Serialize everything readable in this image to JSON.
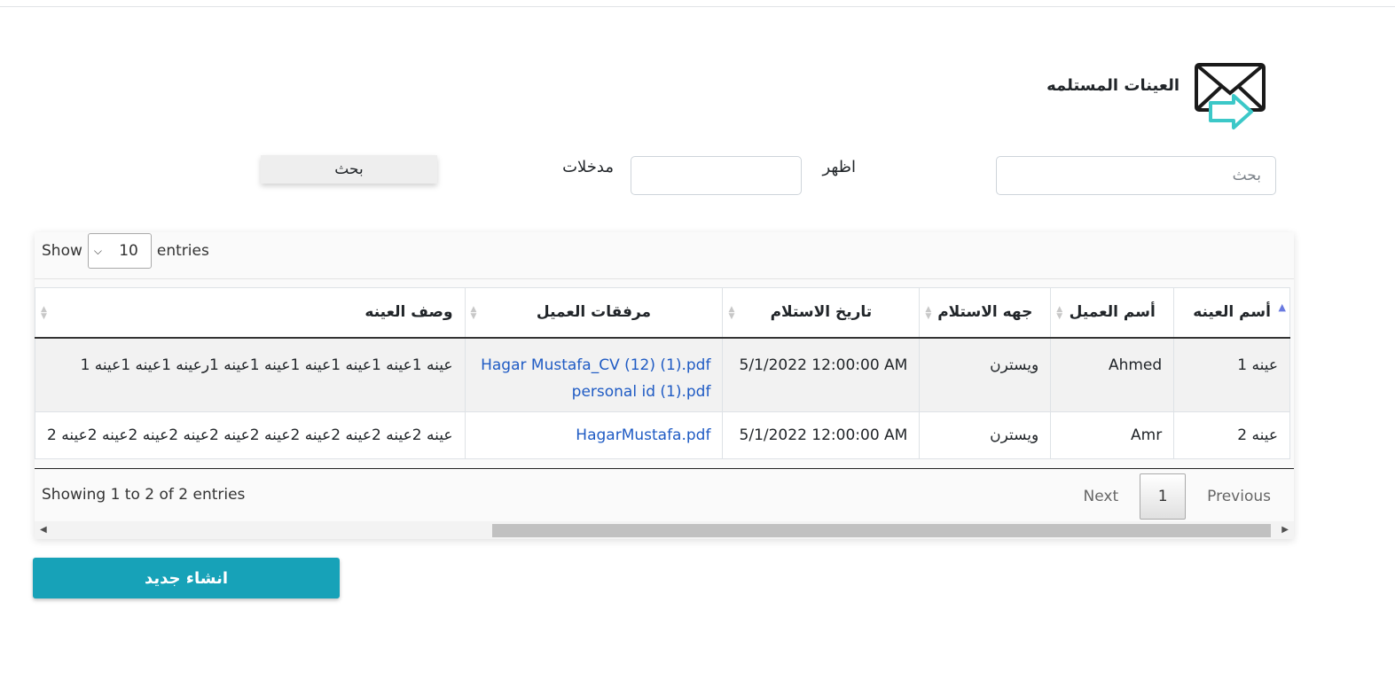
{
  "header": {
    "title": "العينات المستلمه"
  },
  "filters": {
    "search_placeholder": "بحث",
    "show_label": "اظهر",
    "count_value": "",
    "entries_label": "مدخلات",
    "search_button": "بحث"
  },
  "table": {
    "length": {
      "show": "Show",
      "value": "10",
      "entries": "entries"
    },
    "columns": [
      "أسم العينه",
      "أسم العميل",
      "جهه الاستلام",
      "تاريخ الاستلام",
      "مرفقات العميل",
      "وصف العينه"
    ],
    "rows": [
      {
        "sample_name": "عينه 1",
        "client_name": "Ahmed",
        "receiver": "ويسترن",
        "received_date": "5/1/2022 12:00:00 AM",
        "attachments": [
          "Hagar Mustafa_CV (12) (1).pdf",
          "personal id (1).pdf"
        ],
        "description": "عينه 1عينه 1عينه 1عينه 1عينه 1عينه 1رعينه 1عينه 1عينه 1"
      },
      {
        "sample_name": "عينه 2",
        "client_name": "Amr",
        "receiver": "ويسترن",
        "received_date": "5/1/2022 12:00:00 AM",
        "attachments": [
          "HagarMustafa.pdf"
        ],
        "description": "عينه 2عينه 2عينه 2عينه 2عينه 2عينه 2عينه 2عينه 2عينه 2عينه 2"
      }
    ],
    "info": "Showing 1 to 2 of 2 entries",
    "pagination": {
      "previous": "Previous",
      "current": "1",
      "next": "Next"
    }
  },
  "actions": {
    "create_label": "انشاء جديد"
  },
  "colors": {
    "accent": "#17a2b8",
    "link": "#1f5bc4",
    "icon_arrow": "#3cc8c8"
  },
  "icons": [
    "envelope-arrow-icon",
    "sort-icon",
    "chevron-down-icon",
    "scroll-left-icon",
    "scroll-right-icon"
  ]
}
